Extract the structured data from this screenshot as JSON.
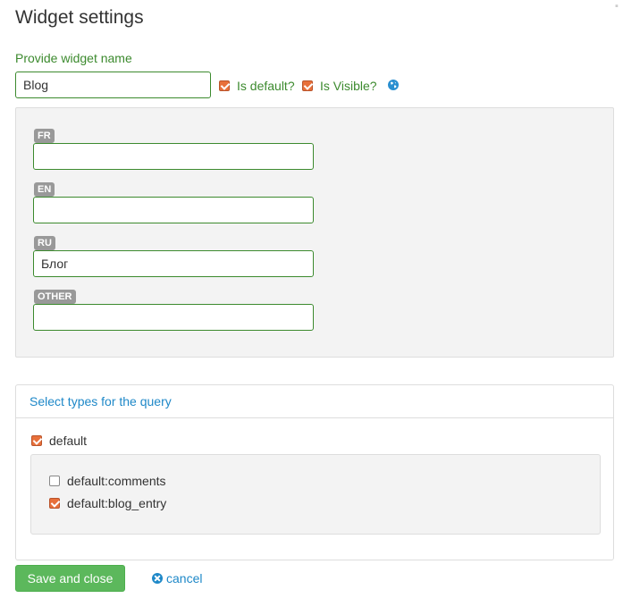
{
  "dialog": {
    "title": "Widget settings",
    "close_glyph": "▪"
  },
  "name_section": {
    "label": "Provide widget name",
    "value": "Blog",
    "is_default_label": "Is default?",
    "is_default_checked": true,
    "is_visible_label": "Is Visible?",
    "is_visible_checked": true,
    "globe_icon": "globe-icon"
  },
  "languages": [
    {
      "code": "FR",
      "value": ""
    },
    {
      "code": "EN",
      "value": ""
    },
    {
      "code": "RU",
      "value": "Блог"
    },
    {
      "code": "OTHER",
      "value": ""
    }
  ],
  "query": {
    "title": "Select types for the query",
    "type": {
      "label": "default",
      "checked": true
    },
    "subtypes": [
      {
        "label": "default:comments",
        "checked": false
      },
      {
        "label": "default:blog_entry",
        "checked": true
      }
    ]
  },
  "actions": {
    "save_label": "Save and close",
    "cancel_label": "cancel"
  },
  "colors": {
    "accent_green": "#3c8a2e",
    "checkbox_orange": "#e8703a",
    "link_blue": "#1e88c8",
    "button_green": "#5cb85c"
  }
}
